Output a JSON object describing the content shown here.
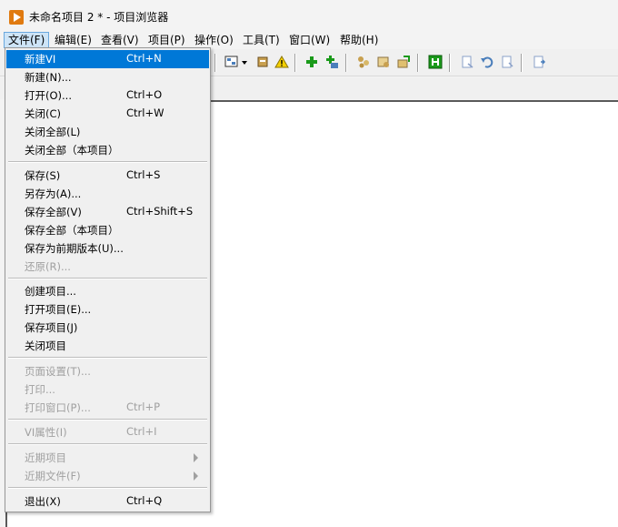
{
  "window": {
    "title": "未命名项目 2 * - 项目浏览器"
  },
  "menubar": {
    "items": [
      {
        "label": "文件(F)",
        "active": true
      },
      {
        "label": "编辑(E)"
      },
      {
        "label": "查看(V)"
      },
      {
        "label": "项目(P)"
      },
      {
        "label": "操作(O)"
      },
      {
        "label": "工具(T)"
      },
      {
        "label": "窗口(W)"
      },
      {
        "label": "帮助(H)"
      }
    ]
  },
  "toolbar": {
    "icons": [
      "project-view-icon",
      "dropdown-arrow-icon",
      "properties-icon",
      "warning-icon",
      "add-item-icon",
      "add-folder-icon",
      "deploy-icon",
      "build-icon",
      "dependencies-icon",
      "run-icon",
      "vi-icon",
      "undo-icon",
      "redo-icon",
      "export-icon"
    ]
  },
  "file_menu": {
    "items": [
      {
        "label": "新建VI",
        "shortcut": "Ctrl+N",
        "highlighted": true
      },
      {
        "label": "新建(N)...",
        "shortcut": ""
      },
      {
        "label": "打开(O)...",
        "shortcut": "Ctrl+O"
      },
      {
        "label": "关闭(C)",
        "shortcut": "Ctrl+W"
      },
      {
        "label": "关闭全部(L)",
        "shortcut": ""
      },
      {
        "label": "关闭全部（本项目）",
        "shortcut": ""
      },
      {
        "label": "保存(S)",
        "shortcut": "Ctrl+S"
      },
      {
        "label": "另存为(A)...",
        "shortcut": ""
      },
      {
        "label": "保存全部(V)",
        "shortcut": "Ctrl+Shift+S"
      },
      {
        "label": "保存全部（本项目）",
        "shortcut": ""
      },
      {
        "label": "保存为前期版本(U)...",
        "shortcut": ""
      },
      {
        "label": "还原(R)...",
        "shortcut": "",
        "disabled": true
      },
      {
        "label": "创建项目...",
        "shortcut": ""
      },
      {
        "label": "打开项目(E)...",
        "shortcut": ""
      },
      {
        "label": "保存项目(J)",
        "shortcut": ""
      },
      {
        "label": "关闭项目",
        "shortcut": ""
      },
      {
        "label": "页面设置(T)...",
        "shortcut": "",
        "disabled": true
      },
      {
        "label": "打印...",
        "shortcut": "",
        "disabled": true
      },
      {
        "label": "打印窗口(P)...",
        "shortcut": "Ctrl+P",
        "disabled": true
      },
      {
        "label": "VI属性(I)",
        "shortcut": "Ctrl+I",
        "disabled": true
      },
      {
        "label": "近期项目",
        "shortcut": "",
        "disabled": true,
        "submenu": true
      },
      {
        "label": "近期文件(F)",
        "shortcut": "",
        "disabled": true,
        "submenu": true
      },
      {
        "label": "退出(X)",
        "shortcut": "Ctrl+Q"
      }
    ]
  },
  "colors": {
    "highlight": "#0078d7",
    "disabled_text": "#a0a0a0",
    "app_icon": "#e07a10"
  }
}
